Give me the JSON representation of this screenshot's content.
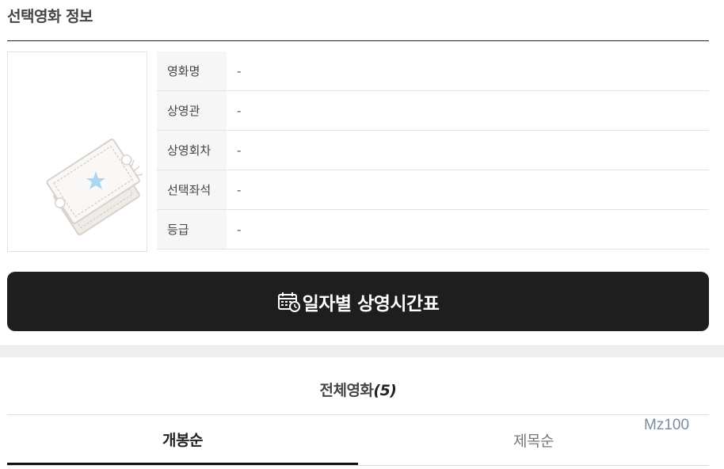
{
  "section": {
    "title": "선택영화 정보"
  },
  "info": {
    "rows": [
      {
        "label": "영화명",
        "value": "-"
      },
      {
        "label": "상영관",
        "value": "-"
      },
      {
        "label": "상영회차",
        "value": "-"
      },
      {
        "label": "선택좌석",
        "value": "-"
      },
      {
        "label": "등급",
        "value": "-"
      }
    ]
  },
  "schedule_button": {
    "label": "일자별 상영시간표"
  },
  "movies": {
    "title": "전체영화",
    "count": "(5)"
  },
  "sort_tabs": [
    {
      "label": "개봉순",
      "active": true
    },
    {
      "label": "제목순",
      "active": false
    }
  ],
  "mz_label": "Mz100",
  "colors": {
    "button_bg": "#1f1e1e",
    "accent_star": "#a8d8f0",
    "mz_text": "#7a8da3"
  }
}
